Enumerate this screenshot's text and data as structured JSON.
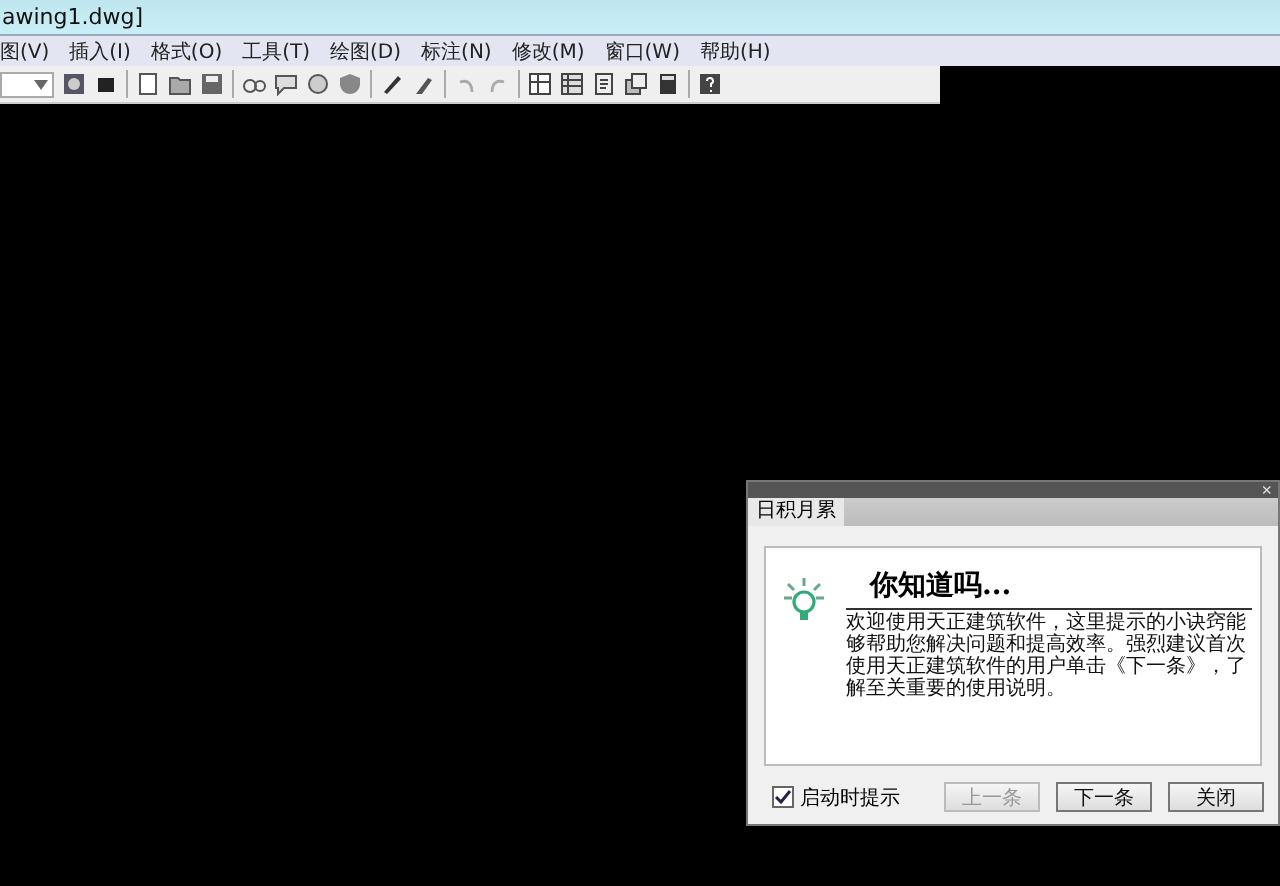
{
  "window": {
    "title": "awing1.dwg]"
  },
  "menu": [
    "图(V)",
    "插入(I)",
    "格式(O)",
    "工具(T)",
    "绘图(D)",
    "标注(N)",
    "修改(M)",
    "窗口(W)",
    "帮助(H)"
  ],
  "dialog": {
    "title": "日积月累",
    "close": "×",
    "heading": "你知道吗...",
    "message": "欢迎使用天正建筑软件，这里提示的小诀窍能够帮助您解决问题和提高效率。强烈建议首次使用天正建筑软件的用户单击《下一条》，了解至关重要的使用说明。",
    "startup_checkbox": {
      "label": "启动时提示",
      "checked": true
    },
    "buttons": [
      {
        "label": "上一条",
        "disabled": true
      },
      {
        "label": "下一条",
        "disabled": false
      },
      {
        "label": "关闭",
        "disabled": false
      }
    ]
  }
}
